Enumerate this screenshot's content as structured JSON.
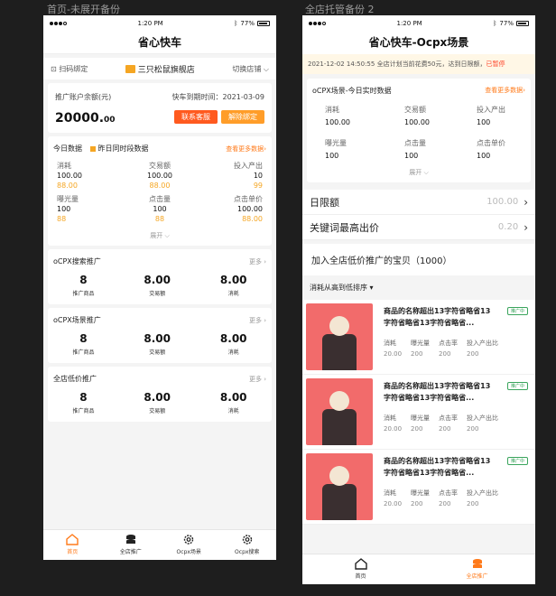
{
  "labels": {
    "left": "首页-未展开备份",
    "right": "全店托管备份 2"
  },
  "status": {
    "time": "1:20 PM",
    "battery": "77%"
  },
  "home": {
    "title": "省心快车",
    "scan": "扫码绑定",
    "shop": "三只松鼠旗舰店",
    "switch": "切换店铺",
    "balance_label": "推广账户余额(元)",
    "expire": "快车到期时间：2021-03-09",
    "balance_int": "20000.",
    "balance_dec": "00",
    "contact": "联系客服",
    "unbind": "解除绑定",
    "today": {
      "title": "今日数据",
      "legend": "昨日同时段数据",
      "more": "查看更多数据",
      "metrics": [
        {
          "label": "消耗",
          "value": "100.00",
          "prev": "88.00"
        },
        {
          "label": "交易额",
          "value": "100.00",
          "prev": "88.00"
        },
        {
          "label": "投入产出",
          "value": "10",
          "prev": "99"
        },
        {
          "label": "曝光量",
          "value": "100",
          "prev": "88"
        },
        {
          "label": "点击量",
          "value": "100",
          "prev": "88"
        },
        {
          "label": "点击单价",
          "value": "100.00",
          "prev": "88.00"
        }
      ],
      "expand": "展开"
    },
    "sections": [
      {
        "title": "oCPX搜索推广",
        "more": "更多",
        "vals": [
          "8",
          "8.00",
          "8.00"
        ],
        "lbls": [
          "推广商品",
          "交易额",
          "消耗"
        ]
      },
      {
        "title": "oCPX场景推广",
        "more": "更多",
        "vals": [
          "8",
          "8.00",
          "8.00"
        ],
        "lbls": [
          "推广商品",
          "交易额",
          "消耗"
        ]
      },
      {
        "title": "全店低价推广",
        "more": "更多",
        "vals": [
          "8",
          "8.00",
          "8.00"
        ],
        "lbls": [
          "推广商品",
          "交易额",
          "消耗"
        ]
      }
    ],
    "tabs": [
      "首页",
      "全店推广",
      "Ocpx场景",
      "Ocpx搜索"
    ]
  },
  "ocpx": {
    "title": "省心快车-Ocpx场景",
    "notice": "2021-12-02 14:50:55 全店计划当前花费50元，达到日限额，",
    "notice_stop": "已暂停",
    "rt_title": "oCPX场景-今日实时数据",
    "rt_more": "查看更多数据",
    "metrics": [
      {
        "label": "消耗",
        "value": "100.00"
      },
      {
        "label": "交易额",
        "value": "100.00"
      },
      {
        "label": "投入产出",
        "value": "100"
      },
      {
        "label": "曝光量",
        "value": "100"
      },
      {
        "label": "点击量",
        "value": "100"
      },
      {
        "label": "点击单价",
        "value": "100"
      }
    ],
    "expand": "展开",
    "daily_label": "日限额",
    "daily_value": "100.00",
    "kw_label": "关键词最高出价",
    "kw_value": "0.20",
    "list_title": "加入全店低价推广的宝贝（1000）",
    "sort": "消耗从高到低排序",
    "products": [
      {
        "name": "商品的名称超出13字符省略省13字符省略省13字符省略省...",
        "tag": "推广中",
        "stats": [
          [
            "消耗",
            "20.00"
          ],
          [
            "曝光量",
            "200"
          ],
          [
            "点击率",
            "200"
          ],
          [
            "投入产出比",
            "200"
          ]
        ]
      },
      {
        "name": "商品的名称超出13字符省略省13字符省略省13字符省略省...",
        "tag": "推广中",
        "stats": [
          [
            "消耗",
            "20.00"
          ],
          [
            "曝光量",
            "200"
          ],
          [
            "点击率",
            "200"
          ],
          [
            "投入产出比",
            "200"
          ]
        ]
      },
      {
        "name": "商品的名称超出13字符省略省13字符省略省13字符省略省...",
        "tag": "推广中",
        "stats": [
          [
            "消耗",
            "20.00"
          ],
          [
            "曝光量",
            "200"
          ],
          [
            "点击率",
            "200"
          ],
          [
            "投入产出比",
            "200"
          ]
        ]
      }
    ],
    "tabs": [
      "首页",
      "全店推广"
    ]
  }
}
